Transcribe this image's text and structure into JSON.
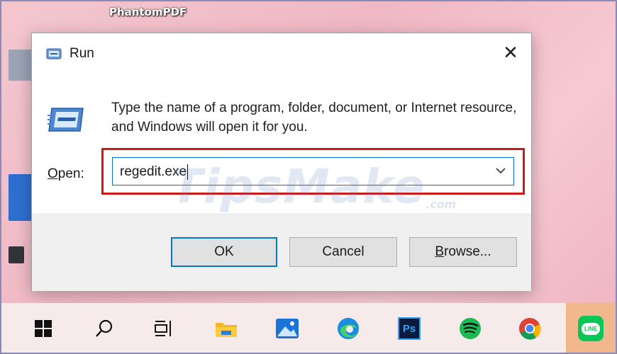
{
  "desktop": {
    "icon_label": "PhantomPDF"
  },
  "dialog": {
    "title": "Run",
    "close_glyph": "✕",
    "description": "Type the name of a program, folder, document, or Internet resource, and Windows will open it for you.",
    "open_label_prefix": "O",
    "open_label_rest": "pen:",
    "input_value": "regedit.exe",
    "ok_label": "OK",
    "cancel_label": "Cancel",
    "browse_label_prefix": "B",
    "browse_label_rest": "rowse..."
  },
  "watermark": {
    "text": "TipsMake",
    "suffix": ".com"
  },
  "taskbar": {
    "icons": [
      "windows-start-icon",
      "search-icon",
      "task-view-icon",
      "file-explorer-icon",
      "photos-icon",
      "edge-icon",
      "photoshop-icon",
      "spotify-icon",
      "chrome-icon",
      "line-icon"
    ],
    "photoshop_text": "Ps",
    "line_text": "LINE"
  },
  "colors": {
    "highlight": "#d01818",
    "accent": "#0078d7",
    "taskbar_active": "#f1b88e"
  }
}
